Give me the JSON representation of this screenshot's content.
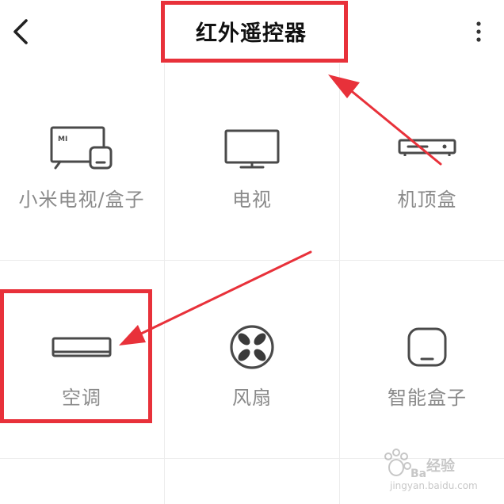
{
  "header": {
    "title": "红外遥控器",
    "back_icon": "chevron-left-icon",
    "more_icon": "more-vertical-icon"
  },
  "devices": [
    {
      "label": "小米电视/盒子",
      "icon": "mi-tv-box-icon"
    },
    {
      "label": "电视",
      "icon": "tv-icon"
    },
    {
      "label": "机顶盒",
      "icon": "set-top-box-icon"
    },
    {
      "label": "空调",
      "icon": "air-conditioner-icon"
    },
    {
      "label": "风扇",
      "icon": "fan-icon"
    },
    {
      "label": "智能盒子",
      "icon": "smart-box-icon"
    }
  ],
  "mi_logo_text": "MI",
  "watermark": {
    "line1": "经验",
    "line2": "jingyan.baidu.com"
  },
  "colors": {
    "annotation": "#e8313a",
    "icon": "#4a4a4a",
    "label": "#8a8a8a"
  }
}
